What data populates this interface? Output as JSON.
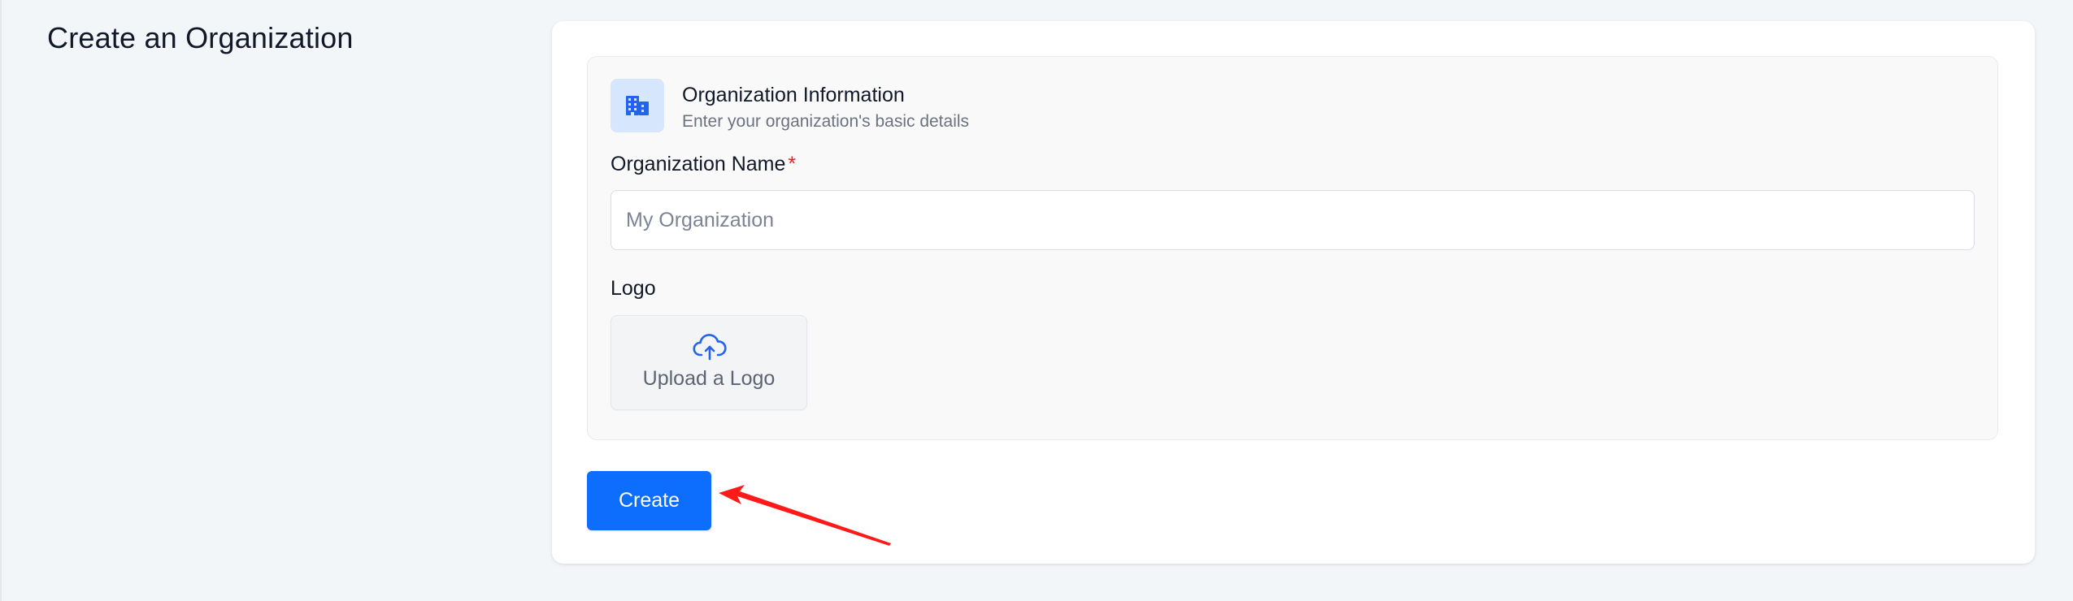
{
  "page": {
    "title": "Create an Organization"
  },
  "section": {
    "icon": "building-icon",
    "title": "Organization Information",
    "subtitle": "Enter your organization's basic details"
  },
  "fields": {
    "name": {
      "label": "Organization Name",
      "required_mark": "*",
      "value": "",
      "placeholder": "My Organization"
    },
    "logo": {
      "label": "Logo",
      "upload_icon": "cloud-upload-icon",
      "upload_label": "Upload a Logo"
    }
  },
  "actions": {
    "create_label": "Create"
  },
  "annotation": {
    "icon": "red-arrow-icon"
  },
  "colors": {
    "background": "#f3f6f9",
    "card": "#ffffff",
    "section": "#f9f9fa",
    "icon_tile": "#d6e6fd",
    "accent": "#0d6efd",
    "required": "#dc2626",
    "annotation": "#ff1a1a"
  }
}
